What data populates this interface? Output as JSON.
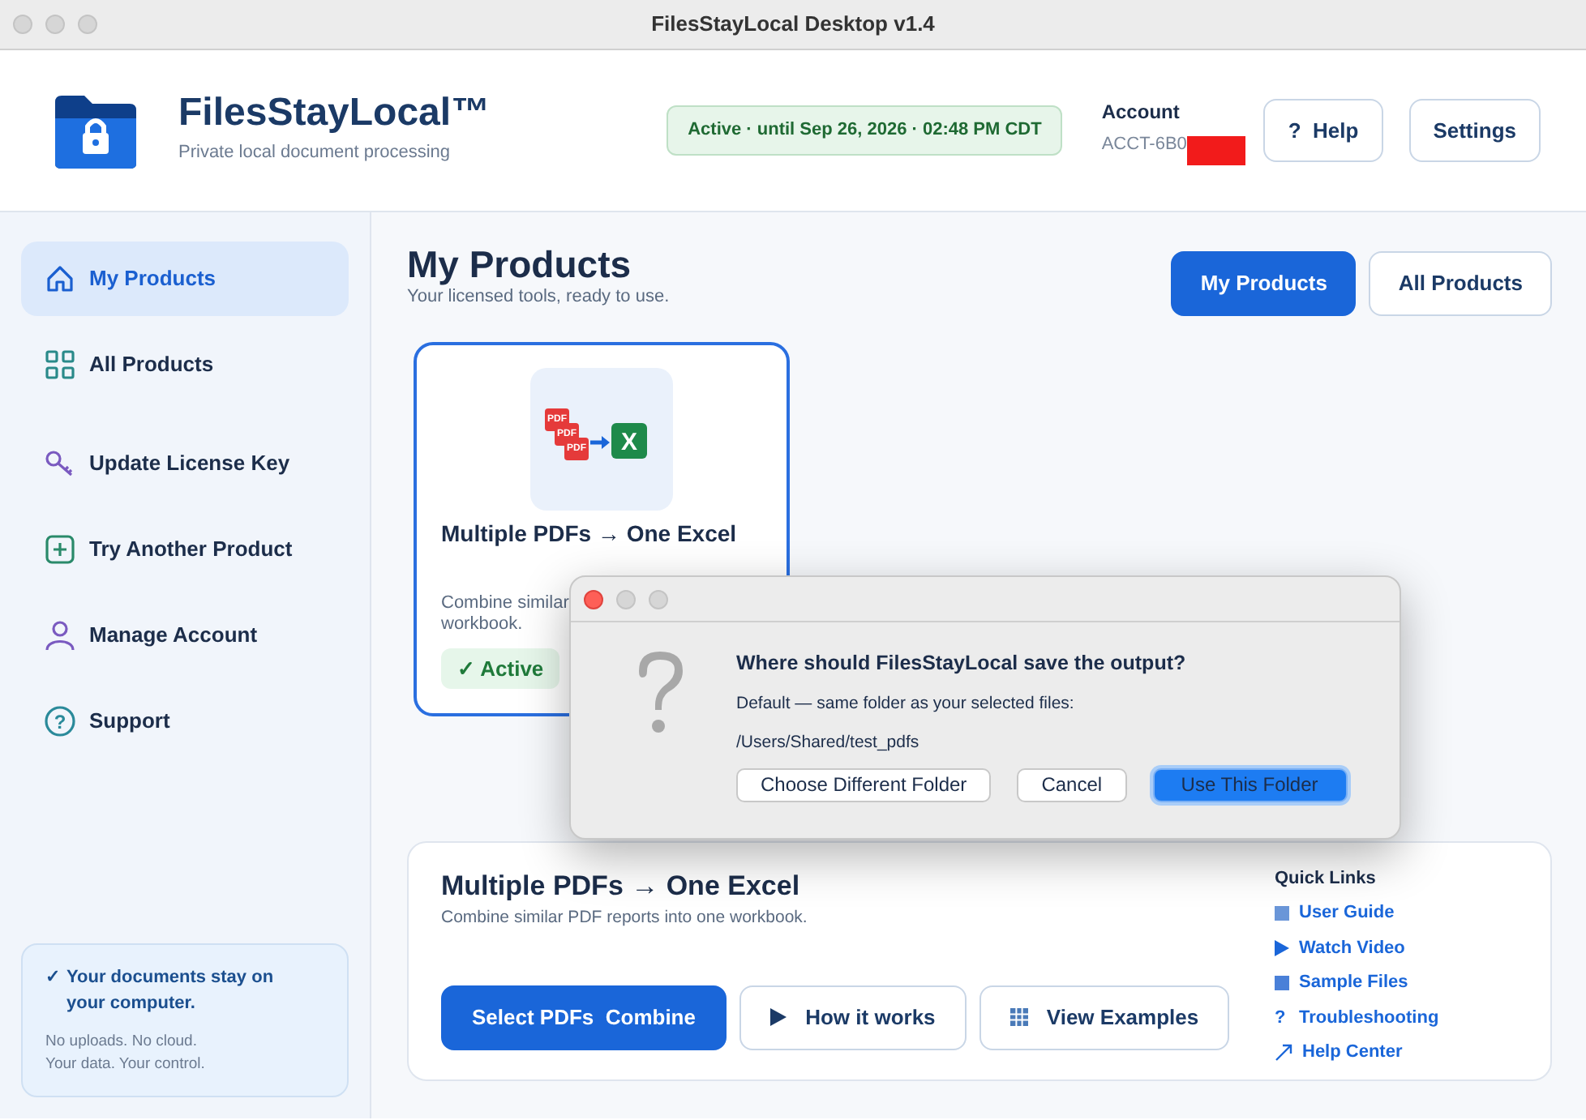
{
  "window": {
    "title": "FilesStayLocal Desktop v1.4"
  },
  "header": {
    "app_name": "FilesStayLocal™",
    "tagline": "Private local document processing",
    "status": "Active · until Sep 26, 2026 · 02:48 PM CDT",
    "account_label": "Account",
    "account_id": "ACCT-6B0",
    "buttons": [
      {
        "icon": "?",
        "label": "Help"
      },
      {
        "label": "Settings"
      }
    ]
  },
  "sidebar": {
    "items": [
      {
        "label": "My Products",
        "selected": true
      },
      {
        "label": "All Products",
        "selected": false
      },
      {
        "label": "Update License Key",
        "selected": false
      },
      {
        "label": "Try Another Product",
        "selected": false
      },
      {
        "label": "Manage Account",
        "selected": false
      },
      {
        "label": "Support",
        "selected": false
      }
    ],
    "notice": {
      "check": "✓",
      "title": "Your documents stay on your computer.",
      "lines": [
        "No uploads. No cloud.",
        "Your data. Your control."
      ]
    }
  },
  "main": {
    "title": "My Products",
    "subtitle": "Your licensed tools, ready to use.",
    "tabs": [
      {
        "label": "My Products",
        "selected": true
      },
      {
        "label": "All Products",
        "selected": false
      }
    ],
    "product_card": {
      "icon_labels": [
        "PDF",
        "PDF",
        "PDF",
        "X"
      ],
      "title": "Multiple PDFs → One Excel",
      "description_lines": [
        "Combine similar",
        "workbook."
      ],
      "status": "✓ Active",
      "selected": true
    },
    "detail": {
      "title": "Multiple PDFs → One Excel",
      "subtitle": "Combine similar PDF reports into one workbook.",
      "buttons": [
        {
          "label": "Select PDFs  Combine",
          "kind": "primary"
        },
        {
          "label": "How it works",
          "kind": "outline"
        },
        {
          "label": "View Examples",
          "kind": "outline"
        }
      ],
      "quick_links": {
        "title": "Quick Links",
        "items": [
          {
            "label": "User Guide"
          },
          {
            "label": "Watch Video"
          },
          {
            "label": "Sample Files"
          },
          {
            "label": "Troubleshooting",
            "icon": "?"
          },
          {
            "label": "Help Center"
          }
        ]
      }
    }
  },
  "dialog": {
    "question": "Where should FilesStayLocal save the output?",
    "message": "Default — same folder as your selected files:",
    "path": "/Users/Shared/test_pdfs",
    "buttons": [
      {
        "label": "Choose Different Folder",
        "default": false
      },
      {
        "label": "Cancel",
        "default": false
      },
      {
        "label": "Use This Folder",
        "default": true
      }
    ]
  }
}
